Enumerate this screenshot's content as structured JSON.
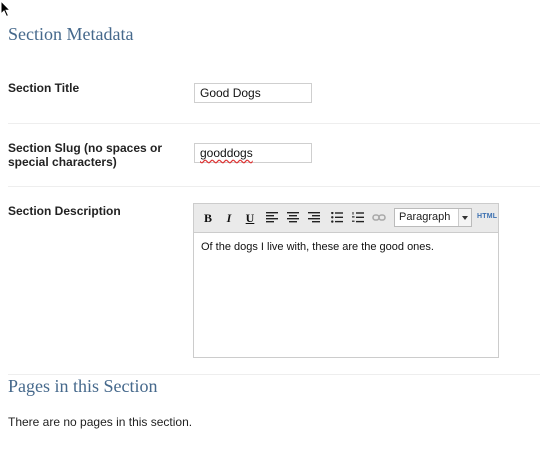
{
  "metadata": {
    "heading": "Section Metadata",
    "title_label": "Section Title",
    "title_value": "Good Dogs",
    "slug_label_line1": "Section Slug (no spaces or",
    "slug_label_line2": "special characters)",
    "slug_value": "gooddogs",
    "description_label": "Section Description"
  },
  "editor": {
    "toolbar": [
      {
        "name": "bold-icon",
        "glyph": "B"
      },
      {
        "name": "italic-icon",
        "glyph": "I"
      },
      {
        "name": "underline-icon",
        "glyph": "U"
      },
      {
        "name": "align-left-icon"
      },
      {
        "name": "align-center-icon"
      },
      {
        "name": "align-right-icon"
      },
      {
        "name": "bullet-list-icon"
      },
      {
        "name": "numbered-list-icon"
      },
      {
        "name": "link-icon"
      }
    ],
    "format_value": "Paragraph",
    "html_label": "HTML",
    "content": "Of the dogs I live with, these are the good ones."
  },
  "pages": {
    "heading": "Pages in this Section",
    "empty_message": "There are no pages in this section."
  },
  "colors": {
    "heading": "#46698c",
    "toolbar_bg": "#eaeaea",
    "html_link": "#3a6fb0"
  }
}
